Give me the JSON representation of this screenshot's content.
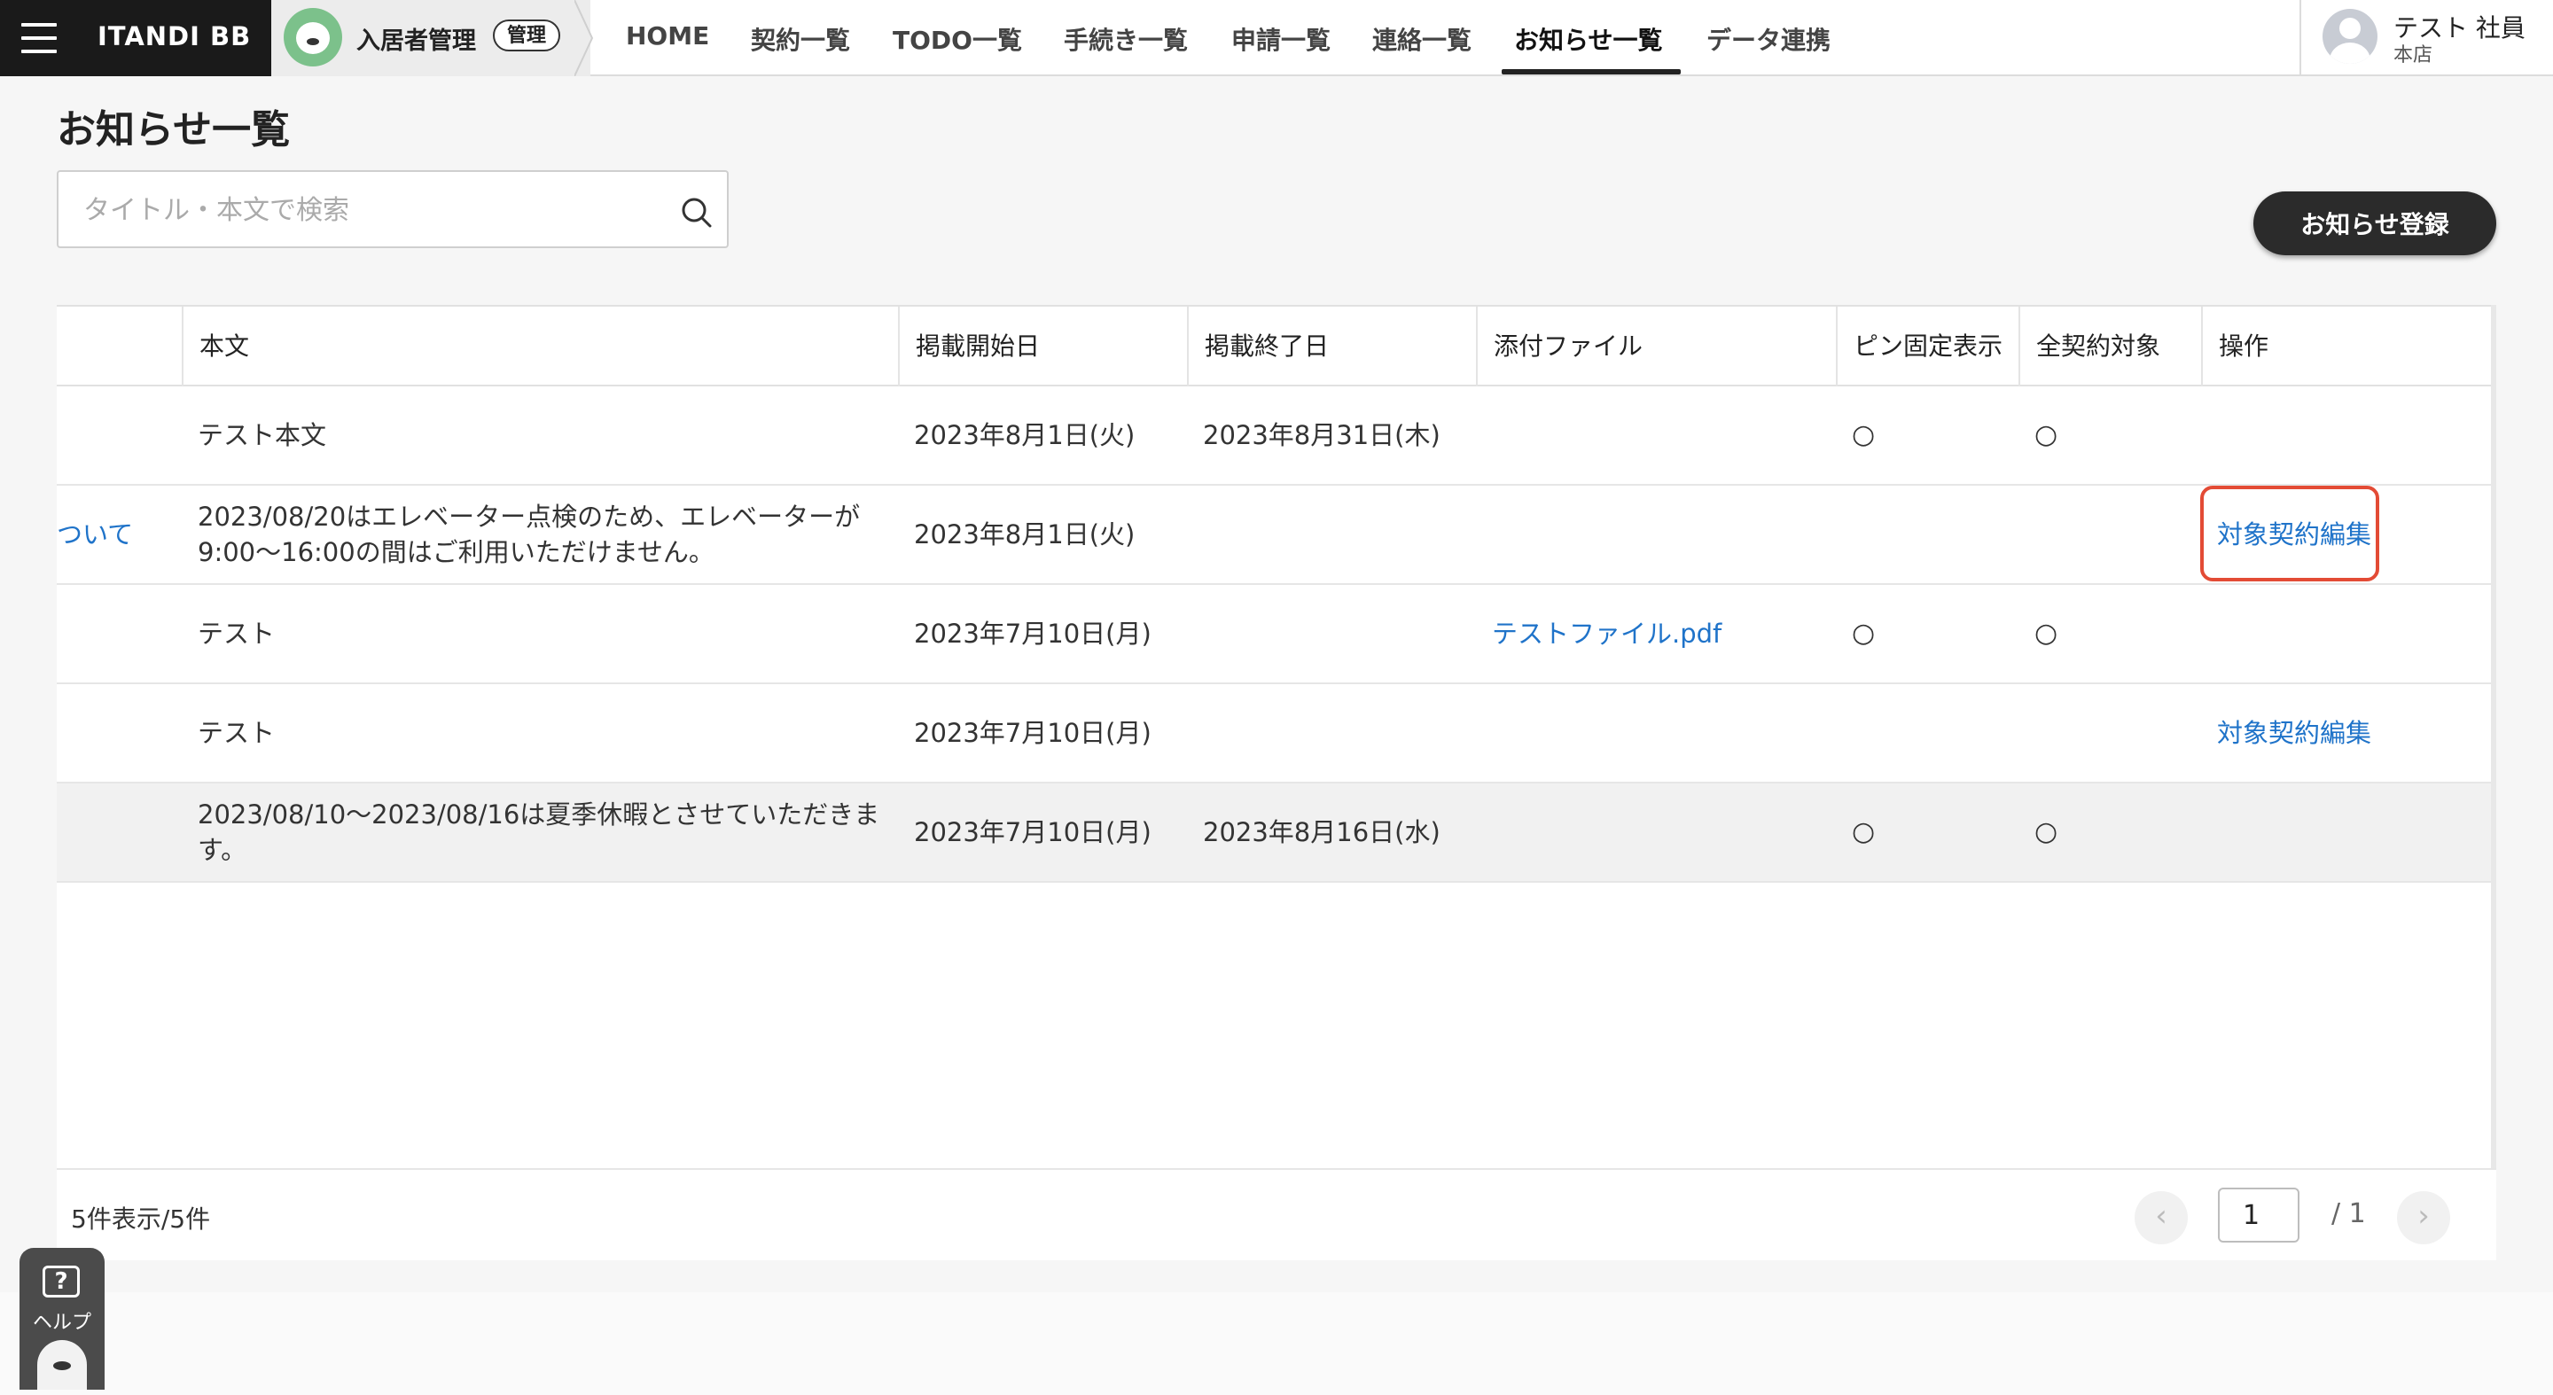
{
  "header": {
    "brand": "ITANDI BB",
    "product_name": "入居者管理",
    "product_badge": "管理",
    "nav": [
      "HOME",
      "契約一覧",
      "TODO一覧",
      "手続き一覧",
      "申請一覧",
      "連絡一覧",
      "お知らせ一覧",
      "データ連携"
    ],
    "active_nav": "お知らせ一覧",
    "user": {
      "name": "テスト 社員",
      "branch": "本店"
    }
  },
  "page": {
    "title": "お知らせ一覧",
    "search_placeholder": "タイトル・本文で検索",
    "register_button": "お知らせ登録"
  },
  "table": {
    "columns": [
      "本文",
      "掲載開始日",
      "掲載終了日",
      "添付ファイル",
      "ピン固定表示",
      "全契約対象",
      "操作"
    ],
    "rows": [
      {
        "title_fragment": "",
        "body": [
          "テスト本文"
        ],
        "start": "2023年8月1日(火)",
        "end": "2023年8月31日(木)",
        "attachment": "",
        "pinned": "○",
        "all_contracts": "○",
        "action": ""
      },
      {
        "title_fragment": "ついて",
        "body": [
          "2023/08/20はエレベーター点検のため、エレベーターが",
          "9:00〜16:00の間はご利用いただけません。"
        ],
        "start": "2023年8月1日(火)",
        "end": "",
        "attachment": "",
        "pinned": "",
        "all_contracts": "",
        "action": "対象契約編集"
      },
      {
        "title_fragment": "",
        "body": [
          "テスト"
        ],
        "start": "2023年7月10日(月)",
        "end": "",
        "attachment": "テストファイル.pdf",
        "pinned": "○",
        "all_contracts": "○",
        "action": ""
      },
      {
        "title_fragment": "",
        "body": [
          "テスト"
        ],
        "start": "2023年7月10日(月)",
        "end": "",
        "attachment": "",
        "pinned": "",
        "all_contracts": "",
        "action": "対象契約編集"
      },
      {
        "title_fragment": "",
        "body": [
          "2023/08/10〜2023/08/16は夏季休暇とさせていただきま",
          "す。"
        ],
        "start": "2023年7月10日(月)",
        "end": "2023年8月16日(水)",
        "attachment": "",
        "pinned": "○",
        "all_contracts": "○",
        "action": ""
      }
    ]
  },
  "pagination": {
    "count_text": "5件表示/5件",
    "current_page": "1",
    "total": "/ 1",
    "prev_icon": "‹",
    "next_icon": "›"
  },
  "help": {
    "label": "ヘルプ",
    "icon_text": "?"
  },
  "colors": {
    "link": "#1f73c9",
    "highlight": "#e34b35",
    "dark": "#2b2b2b"
  }
}
